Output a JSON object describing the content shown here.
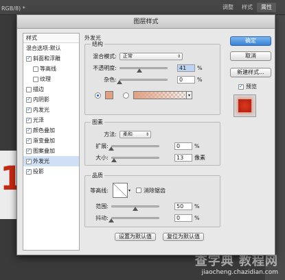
{
  "background": {
    "doc_tab": "RGB/8) *",
    "panel_tabs": [
      "调整",
      "样式",
      "属性"
    ],
    "canvas_digit": "1",
    "watermark_main": "查字典 教程网",
    "watermark_sub": "jiaocheng.chazidian.com"
  },
  "dialog": {
    "title": "图层样式",
    "style_list": {
      "header": "样式",
      "items": [
        {
          "label": "混合选项:默认",
          "checkbox": false,
          "checked": false,
          "indent": false,
          "selected": false
        },
        {
          "label": "斜面和浮雕",
          "checkbox": true,
          "checked": true,
          "indent": false,
          "selected": false
        },
        {
          "label": "等高线",
          "checkbox": true,
          "checked": false,
          "indent": true,
          "selected": false
        },
        {
          "label": "纹理",
          "checkbox": true,
          "checked": false,
          "indent": true,
          "selected": false
        },
        {
          "label": "描边",
          "checkbox": true,
          "checked": false,
          "indent": false,
          "selected": false
        },
        {
          "label": "内阴影",
          "checkbox": true,
          "checked": true,
          "indent": false,
          "selected": false
        },
        {
          "label": "内发光",
          "checkbox": true,
          "checked": true,
          "indent": false,
          "selected": false
        },
        {
          "label": "光泽",
          "checkbox": true,
          "checked": true,
          "indent": false,
          "selected": false
        },
        {
          "label": "颜色叠加",
          "checkbox": true,
          "checked": true,
          "indent": false,
          "selected": false
        },
        {
          "label": "渐变叠加",
          "checkbox": true,
          "checked": true,
          "indent": false,
          "selected": false
        },
        {
          "label": "图案叠加",
          "checkbox": true,
          "checked": true,
          "indent": false,
          "selected": false
        },
        {
          "label": "外发光",
          "checkbox": true,
          "checked": true,
          "indent": false,
          "selected": true
        },
        {
          "label": "投影",
          "checkbox": true,
          "checked": true,
          "indent": false,
          "selected": false
        }
      ]
    },
    "panel": {
      "title": "外发光",
      "structure": {
        "title": "结构",
        "blend_mode_label": "混合模式:",
        "blend_mode_value": "正常",
        "opacity_label": "不透明度:",
        "opacity_value": "41",
        "opacity_percent": 41,
        "noise_label": "杂色:",
        "noise_value": "0",
        "noise_percent": 0,
        "unit_percent": "%",
        "glow_color": "#e0a183"
      },
      "elements": {
        "title": "图素",
        "method_label": "方法:",
        "method_value": "柔和",
        "spread_label": "扩展:",
        "spread_value": "0",
        "spread_percent": 0,
        "size_label": "大小:",
        "size_value": "13",
        "size_percent": 5,
        "size_unit": "像素",
        "unit_percent": "%"
      },
      "quality": {
        "title": "品质",
        "contour_label": "等高线:",
        "antialias_label": "消除锯齿",
        "range_label": "范围:",
        "range_value": "50",
        "range_percent": 50,
        "jitter_label": "抖动:",
        "jitter_value": "0",
        "jitter_percent": 0,
        "unit_percent": "%"
      },
      "set_default_label": "设置为默认值",
      "reset_default_label": "复位为默认值"
    },
    "buttons": {
      "ok": "确定",
      "cancel": "取消",
      "new_style": "新建样式...",
      "preview_label": "预览",
      "preview_checked": true
    }
  }
}
